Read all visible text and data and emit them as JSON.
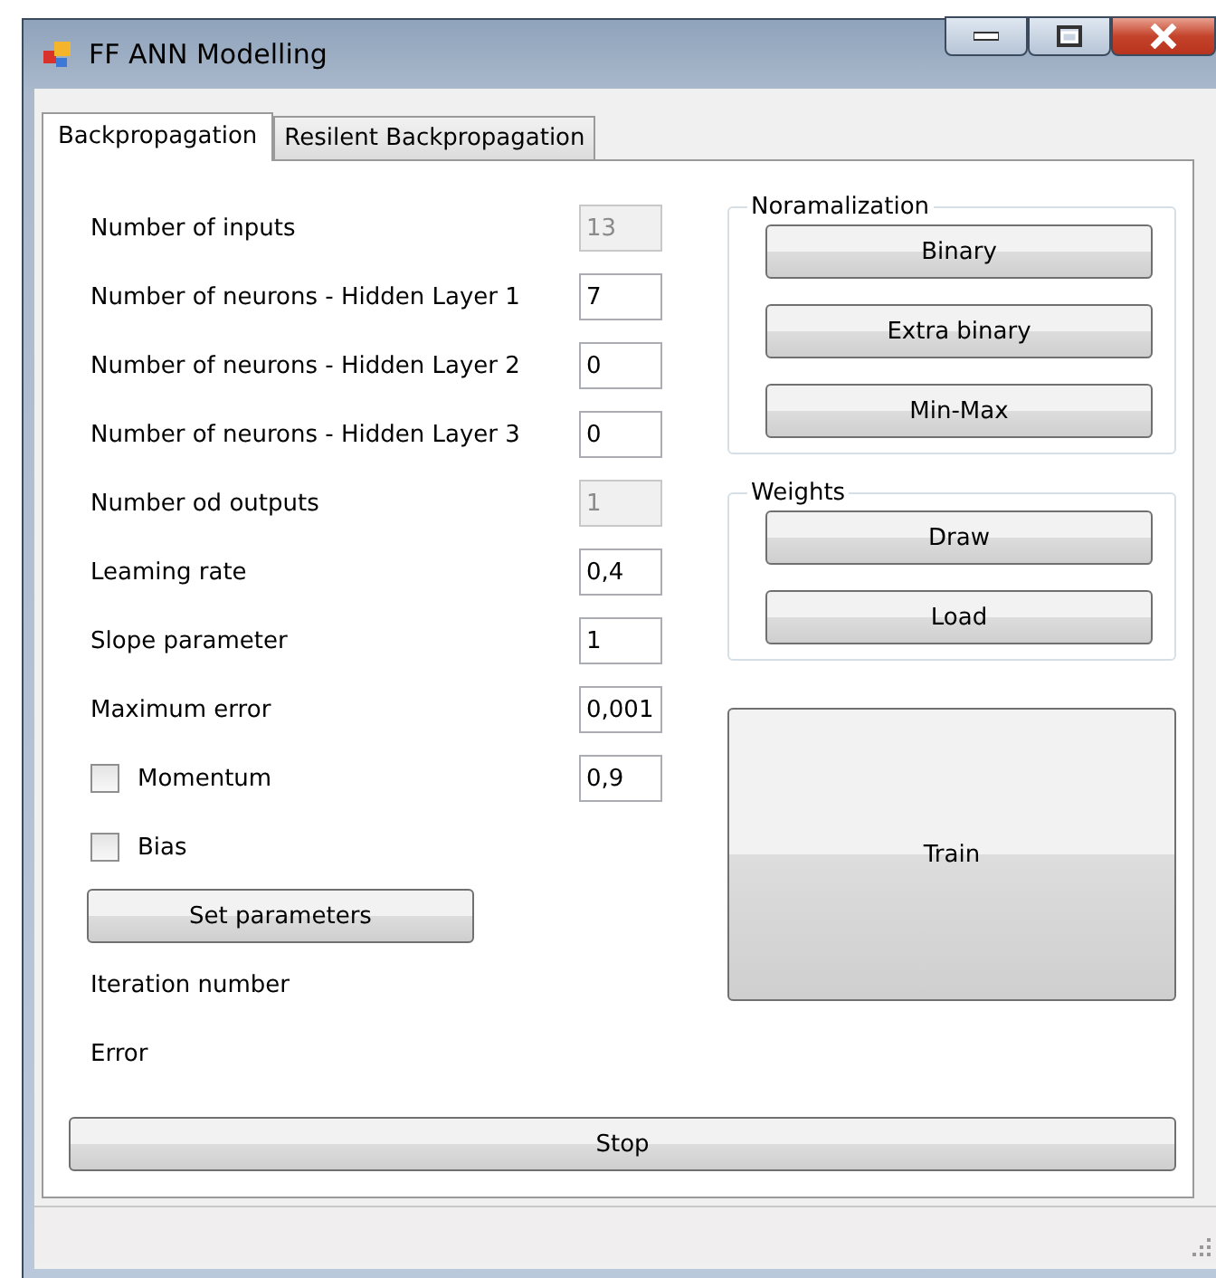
{
  "window": {
    "title": "FF ANN Modelling"
  },
  "tabs": [
    {
      "label": "Backpropagation",
      "selected": true
    },
    {
      "label": "Resilent Backpropagation",
      "selected": false
    }
  ],
  "parameters": [
    {
      "kind": "field",
      "label": "Number of inputs",
      "value": "13",
      "disabled": true
    },
    {
      "kind": "field",
      "label": "Number of neurons - Hidden Layer 1",
      "value": "7",
      "disabled": false
    },
    {
      "kind": "field",
      "label": "Number of neurons - Hidden Layer 2",
      "value": "0",
      "disabled": false
    },
    {
      "kind": "field",
      "label": "Number of neurons - Hidden Layer 3",
      "value": "0",
      "disabled": false
    },
    {
      "kind": "field",
      "label": "Number od outputs",
      "value": "1",
      "disabled": true
    },
    {
      "kind": "field",
      "label": "Leaming rate",
      "value": "0,4",
      "disabled": false
    },
    {
      "kind": "field",
      "label": "Slope parameter",
      "value": "1",
      "disabled": false
    },
    {
      "kind": "field",
      "label": "Maximum error",
      "value": "0,001",
      "disabled": false
    },
    {
      "kind": "checkbox",
      "label": "Momentum",
      "checked": false,
      "value": "0,9"
    },
    {
      "kind": "checkbox",
      "label": "Bias",
      "checked": false
    },
    {
      "kind": "button",
      "label": "Set parameters"
    },
    {
      "kind": "text",
      "label": "Iteration number"
    },
    {
      "kind": "text",
      "label": "Error"
    }
  ],
  "groups": [
    {
      "title": "Noramalization",
      "buttons": [
        "Binary",
        "Extra binary",
        "Min-Max"
      ]
    },
    {
      "title": "Weights",
      "buttons": [
        "Draw",
        "Load"
      ]
    }
  ],
  "train_button": "Train",
  "stop_button": "Stop"
}
